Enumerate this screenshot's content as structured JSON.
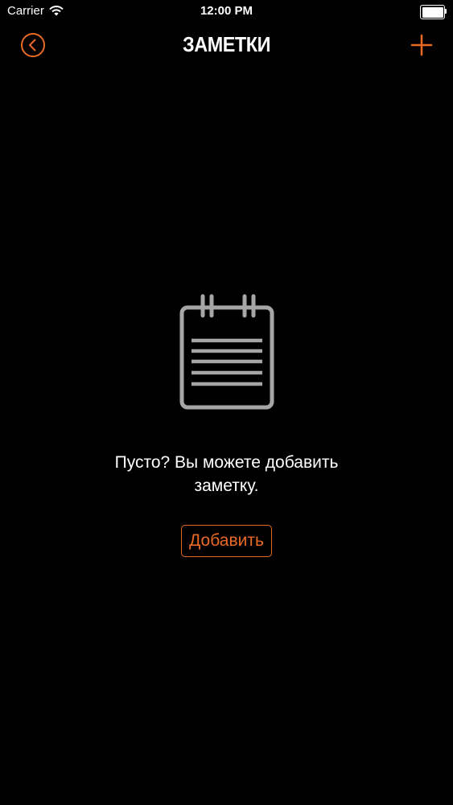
{
  "status_bar": {
    "carrier": "Carrier",
    "time": "12:00 PM",
    "wifi_icon": "wifi-icon",
    "battery_icon": "battery-icon",
    "battery_level": 1.0
  },
  "nav": {
    "title": "ЗАМЕТКИ",
    "back_icon": "back-circle-icon",
    "add_icon": "plus-icon"
  },
  "empty_state": {
    "icon": "notepad-icon",
    "message": "Пусто? Вы можете добавить заметку.",
    "add_button_label": "Добавить"
  },
  "colors": {
    "background": "#000000",
    "accent": "#ea6a24",
    "text": "#ffffff",
    "icon_gray": "#a6a6a6"
  }
}
